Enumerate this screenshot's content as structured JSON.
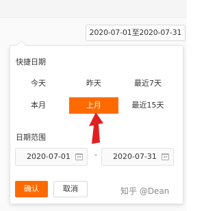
{
  "range_input": {
    "value": "2020-07-01至2020-07-31"
  },
  "panel": {
    "quick_title": "快捷日期",
    "quick_items": [
      {
        "label": "今天"
      },
      {
        "label": "昨天"
      },
      {
        "label": "最近7天"
      },
      {
        "label": "本月"
      },
      {
        "label": "上月",
        "active": true
      },
      {
        "label": "最近15天"
      }
    ],
    "range_title": "日期范围",
    "start_date": "2020-07-01",
    "separator": "-",
    "end_date": "2020-07-31",
    "confirm_label": "确认",
    "cancel_label": "取消"
  },
  "watermark": "知乎 @Dean",
  "colors": {
    "accent": "#ff6a00",
    "annotation_arrow": "#e02020"
  },
  "icons": [
    "calendar-icon",
    "annotation-arrow"
  ]
}
